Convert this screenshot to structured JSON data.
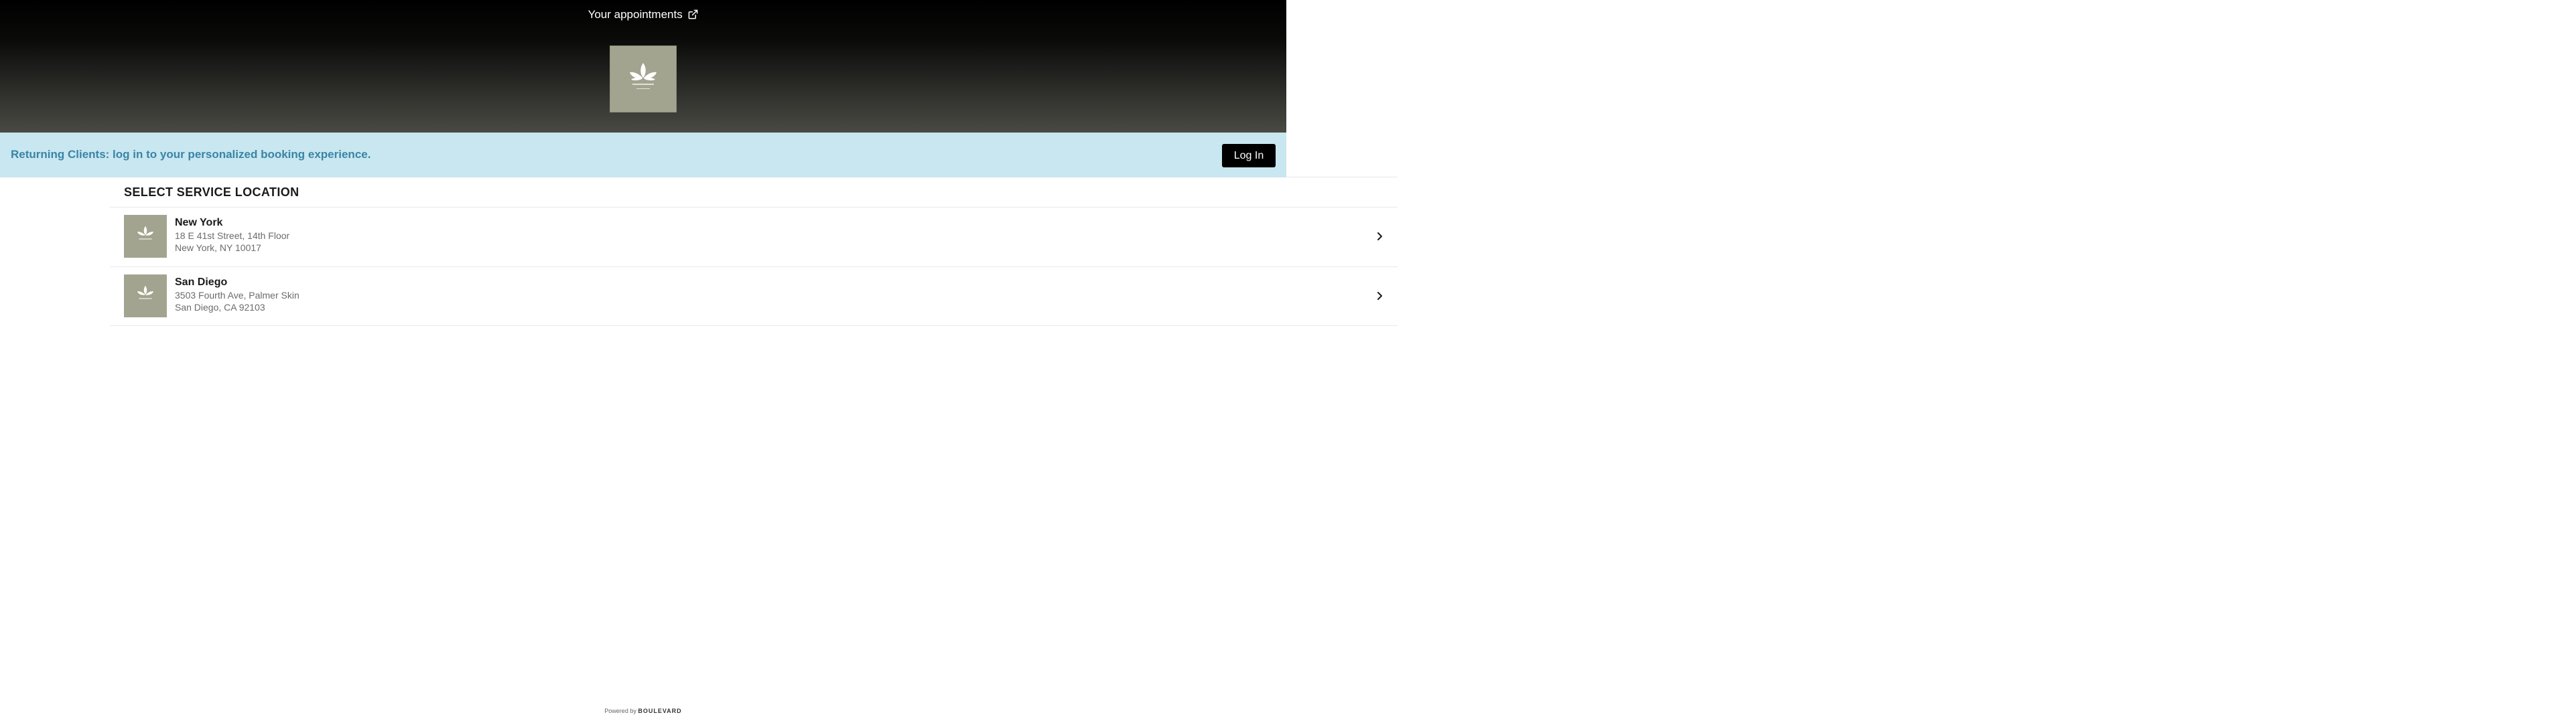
{
  "header": {
    "appointments_link": "Your appointments"
  },
  "banner": {
    "text": "Returning Clients: log in to your personalized booking experience.",
    "login_label": "Log In"
  },
  "locations": {
    "title": "SELECT SERVICE LOCATION",
    "items": [
      {
        "name": "New York",
        "address_line1": "18 E 41st Street, 14th Floor",
        "address_line2": "New York, NY 10017"
      },
      {
        "name": "San Diego",
        "address_line1": "3503 Fourth Ave, Palmer Skin",
        "address_line2": "San Diego, CA 92103"
      }
    ]
  },
  "footer": {
    "powered_by": "Powered by",
    "brand": "BOULEVARD"
  },
  "colors": {
    "banner_bg": "#c8e7f0",
    "banner_text": "#3a84a6",
    "logo_bg": "#a3a48f",
    "button_bg": "#000000"
  },
  "icons": {
    "appointments_link": "external-link-icon",
    "location_arrow": "chevron-right-icon",
    "logo": "lotus-logo-icon"
  }
}
